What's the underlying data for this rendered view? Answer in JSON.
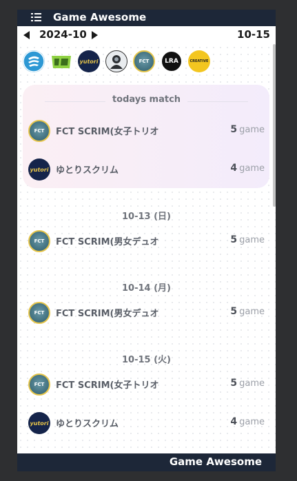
{
  "header": {
    "title": "Game Awesome",
    "menu_icon": "menu-icon"
  },
  "datebar": {
    "month": "2024-10",
    "range": "10-15"
  },
  "logos": [
    {
      "name": "logo-1",
      "text": ""
    },
    {
      "name": "logo-2",
      "text": ""
    },
    {
      "name": "logo-3",
      "text": "yutori"
    },
    {
      "name": "logo-4",
      "text": ""
    },
    {
      "name": "logo-5",
      "text": "FCT"
    },
    {
      "name": "logo-6",
      "text": "LRA"
    },
    {
      "name": "logo-7",
      "text": "CREATIVE"
    }
  ],
  "today": {
    "heading": "todays match",
    "matches": [
      {
        "name": "FCT SCRIM(女子トリオ",
        "count": "5",
        "unit": "game"
      },
      {
        "name": "ゆとりスクリム",
        "count": "4",
        "unit": "game"
      }
    ]
  },
  "days": [
    {
      "heading": "10-13 (日)",
      "matches": [
        {
          "name": "FCT SCRIM(男女デュオ",
          "count": "5",
          "unit": "game"
        }
      ]
    },
    {
      "heading": "10-14 (月)",
      "matches": [
        {
          "name": "FCT SCRIM(男女デュオ",
          "count": "5",
          "unit": "game"
        }
      ]
    },
    {
      "heading": "10-15 (火)",
      "matches": [
        {
          "name": "FCT SCRIM(女子トリオ",
          "count": "5",
          "unit": "game"
        },
        {
          "name": "ゆとりスクリム",
          "count": "4",
          "unit": "game"
        }
      ]
    }
  ],
  "footer": {
    "title": "Game Awesome"
  },
  "colors": {
    "header_bg": "#1d2738",
    "card_bg": "#f6eef8",
    "accent_gold": "#e6c54a"
  }
}
